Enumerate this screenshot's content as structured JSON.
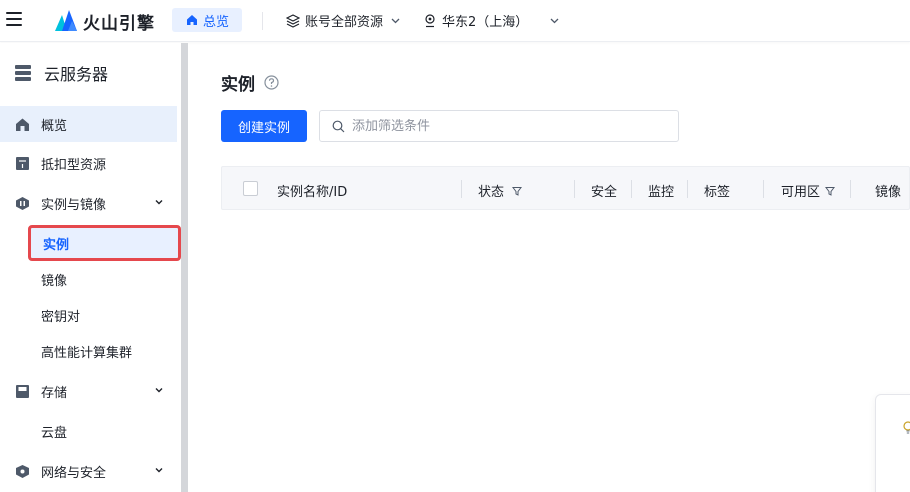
{
  "header": {
    "logo_text": "火山引擎",
    "overview_label": "总览",
    "resource_selector": "账号全部资源",
    "region_selector": "华东2（上海）"
  },
  "sidebar": {
    "title": "云服务器",
    "items": [
      {
        "label": "概览",
        "icon": "home-icon"
      },
      {
        "label": "抵扣型资源",
        "icon": "coupon-icon"
      },
      {
        "label": "实例与镜像",
        "icon": "instance-icon",
        "expanded": true
      },
      {
        "label": "存储",
        "icon": "disk-icon",
        "expanded": true
      },
      {
        "label": "网络与安全",
        "icon": "shield-icon",
        "expanded": true
      }
    ],
    "instance_sub": [
      "实例",
      "镜像",
      "密钥对",
      "高性能计算集群"
    ],
    "storage_sub": [
      "云盘"
    ]
  },
  "main": {
    "title": "实例",
    "create_button": "创建实例",
    "filter_placeholder": "添加筛选条件",
    "columns": [
      "实例名称/ID",
      "状态",
      "安全",
      "监控",
      "标签",
      "可用区",
      "镜像"
    ]
  },
  "colors": {
    "primary": "#1664ff",
    "active_bg": "#e8f0ff",
    "highlight_border": "#e5484d"
  }
}
